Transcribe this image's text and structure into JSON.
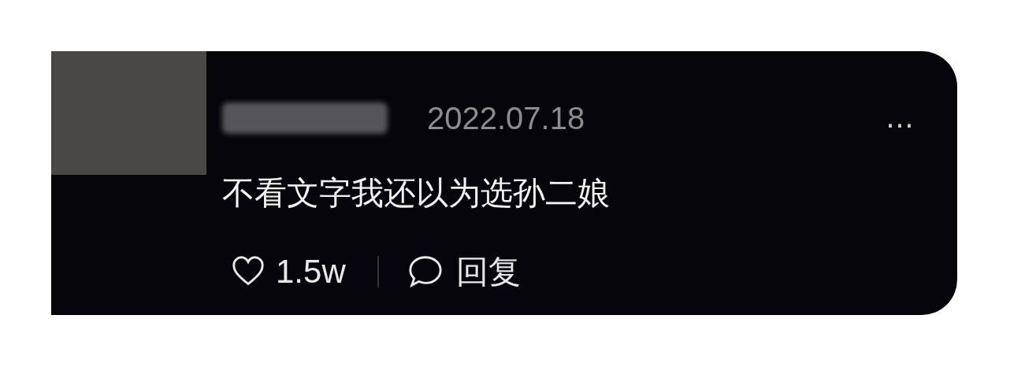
{
  "comment": {
    "date": "2022.07.18",
    "more": "…",
    "text": "不看文字我还以为选孙二娘",
    "likes": "1.5w",
    "reply": "回复"
  }
}
